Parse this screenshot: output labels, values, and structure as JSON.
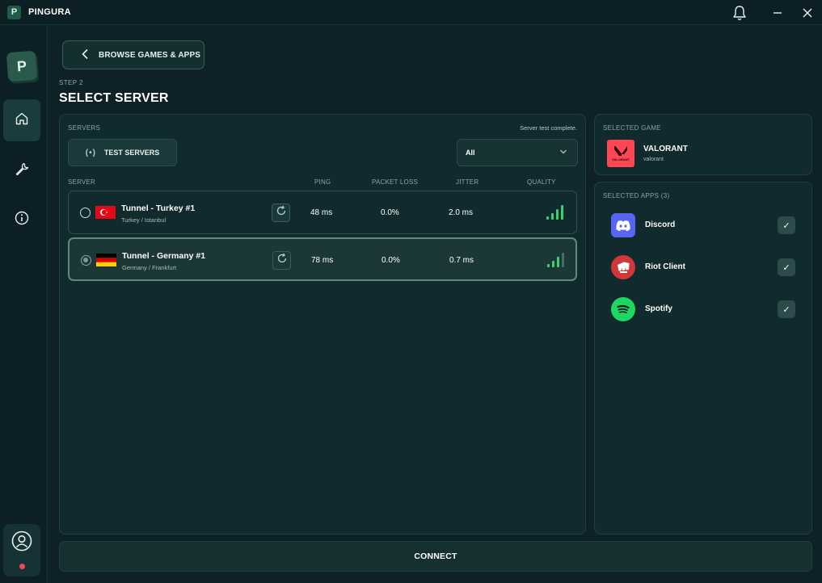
{
  "app": {
    "logo_letter": "P",
    "title": "PINGURA"
  },
  "sidebar": {
    "logo_letter": "P",
    "items": [
      {
        "name": "home",
        "icon": "home-icon",
        "active": true
      },
      {
        "name": "tools",
        "icon": "wrench-icon",
        "active": false
      },
      {
        "name": "info",
        "icon": "info-icon",
        "active": false
      }
    ],
    "user_status_color": "#ef4a52"
  },
  "nav": {
    "browse_label": "BROWSE GAMES & APPS"
  },
  "header": {
    "step": "STEP 2",
    "title": "SELECT SERVER"
  },
  "servers": {
    "label": "SERVERS",
    "status": "Server test complete.",
    "test_button": "TEST SERVERS",
    "test_icon": "(•)",
    "filter_value": "All",
    "columns": {
      "server": "SERVER",
      "ping": "PING",
      "packet_loss": "PACKET LOSS",
      "jitter": "JITTER",
      "quality": "QUALITY"
    },
    "rows": [
      {
        "name": "Tunnel - Turkey #1",
        "country": "Turkey",
        "city": "Istanbul",
        "location": "Turkey  /  Istanbul",
        "flag": "turkey-flag",
        "ping": "48 ms",
        "packet_loss": "0.0%",
        "jitter": "2.0 ms",
        "quality_bars": 4,
        "selected": false
      },
      {
        "name": "Tunnel - Germany #1",
        "country": "Germany",
        "city": "Frankfurt",
        "location": "Germany  /  Frankfurt",
        "flag": "germany-flag",
        "ping": "78 ms",
        "packet_loss": "0.0%",
        "jitter": "0.7 ms",
        "quality_bars": 3,
        "selected": true
      }
    ]
  },
  "selected_game": {
    "label": "SELECTED GAME",
    "name": "VALORANT",
    "subtitle": "valorant",
    "logo_text": "VALORANT",
    "accent": "#ff4655"
  },
  "selected_apps": {
    "label": "SELECTED APPS (3)",
    "items": [
      {
        "name": "Discord",
        "icon": "discord-icon",
        "color": "#5865f2",
        "checked": true,
        "check": "✓"
      },
      {
        "name": "Riot Client",
        "icon": "riot-client-icon",
        "color": "#d13639",
        "checked": true,
        "check": "✓"
      },
      {
        "name": "Spotify",
        "icon": "spotify-icon",
        "color": "#1ed760",
        "checked": true,
        "check": "✓"
      }
    ]
  },
  "connect_label": "CONNECT",
  "colors": {
    "background": "#0d2126",
    "panel": "#112a2d",
    "quality_green": "#3fcf67"
  }
}
